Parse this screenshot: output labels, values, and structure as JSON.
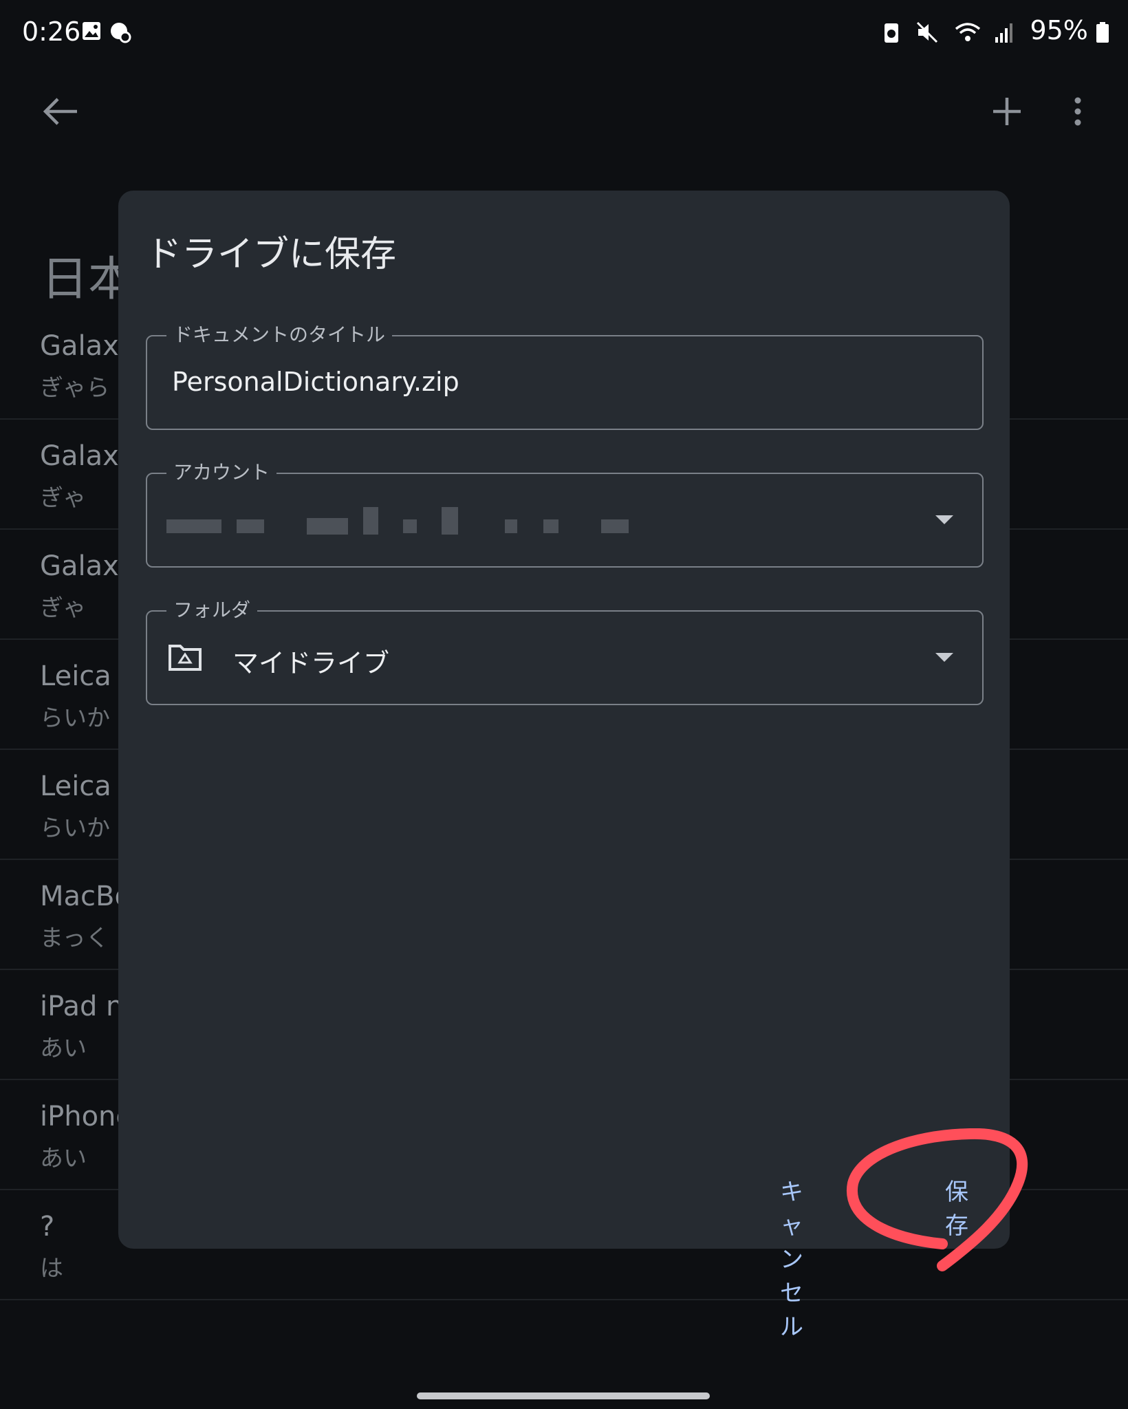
{
  "status_bar": {
    "time": "0:26",
    "battery": "95%"
  },
  "background": {
    "heading": "日本",
    "items": [
      {
        "word": "Galaxy",
        "reading": "ぎゃら"
      },
      {
        "word": "Galaxy",
        "reading": "ぎゃ"
      },
      {
        "word": "Galaxy",
        "reading": "ぎゃ"
      },
      {
        "word": "Leica",
        "reading": "らいか"
      },
      {
        "word": "Leica",
        "reading": "らいか"
      },
      {
        "word": "MacBo",
        "reading": "まっく"
      },
      {
        "word": "iPad n",
        "reading": "あい"
      },
      {
        "word": "iPhone",
        "reading": "あい"
      },
      {
        "word": "?",
        "reading": "は"
      }
    ]
  },
  "dialog": {
    "title": "ドライブに保存",
    "doc_title": {
      "label": "ドキュメントのタイトル",
      "value": "PersonalDictionary.zip"
    },
    "account": {
      "label": "アカウント",
      "value": ""
    },
    "folder": {
      "label": "フォルダ",
      "value": "マイドライブ"
    },
    "cancel_label": "キャンセル",
    "save_label": "保存"
  },
  "colors": {
    "accent": "#a8c7fa",
    "annotation": "#ff4f5a",
    "dialog_bg": "#262b31"
  }
}
